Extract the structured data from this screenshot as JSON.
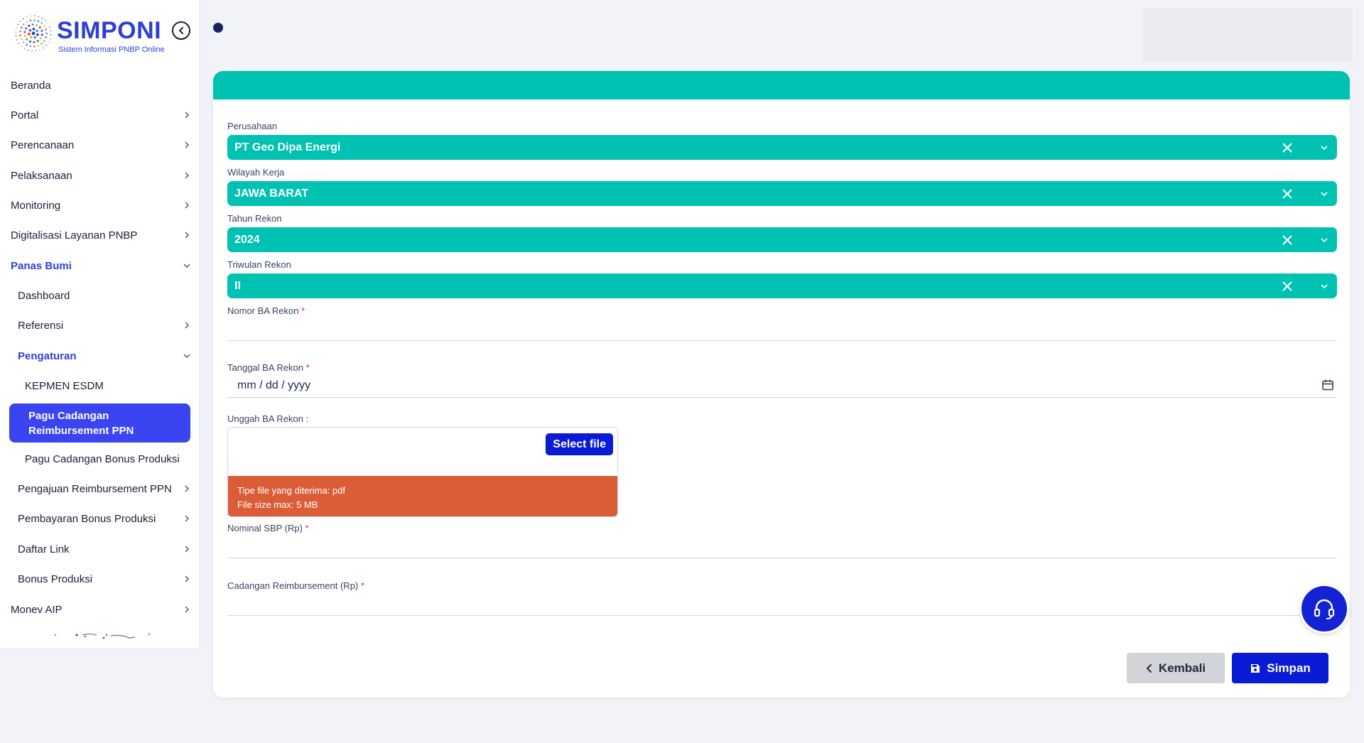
{
  "brand": {
    "title": "SIMPONI",
    "subtitle": "Sistem Informasi PNBP Online"
  },
  "sidebar": {
    "items": [
      {
        "label": "Beranda",
        "chevron": "none"
      },
      {
        "label": "Portal",
        "chevron": "right"
      },
      {
        "label": "Perencanaan",
        "chevron": "right"
      },
      {
        "label": "Pelaksanaan",
        "chevron": "right"
      },
      {
        "label": "Monitoring",
        "chevron": "right"
      },
      {
        "label": "Digitalisasi Layanan PNBP",
        "chevron": "right"
      },
      {
        "label": "Panas Bumi",
        "chevron": "down"
      },
      {
        "label": "Dashboard",
        "chevron": "none"
      },
      {
        "label": "Referensi",
        "chevron": "right"
      },
      {
        "label": "Pengaturan",
        "chevron": "down"
      },
      {
        "label": "KEPMEN ESDM",
        "chevron": "none"
      },
      {
        "label": "Pagu Cadangan Reimbursement PPN",
        "chevron": "none"
      },
      {
        "label": "Pagu Cadangan Bonus Produksi",
        "chevron": "none"
      },
      {
        "label": "Pengajuan Reimbursement PPN",
        "chevron": "right"
      },
      {
        "label": "Pembayaran Bonus Produksi",
        "chevron": "right"
      },
      {
        "label": "Daftar Link",
        "chevron": "right"
      },
      {
        "label": "Bonus Produksi",
        "chevron": "right"
      },
      {
        "label": "Monev AIP",
        "chevron": "right"
      }
    ],
    "active_line1": "Pagu Cadangan",
    "active_line2": "Reimbursement PPN"
  },
  "form": {
    "perusahaan": {
      "label": "Perusahaan",
      "value": "PT Geo Dipa Energi"
    },
    "wilayah": {
      "label": "Wilayah Kerja",
      "value": "JAWA BARAT"
    },
    "tahun": {
      "label": "Tahun Rekon",
      "value": "2024"
    },
    "triwulan": {
      "label": "Triwulan Rekon",
      "value": "II"
    },
    "nomor_ba": {
      "label": "Nomor BA Rekon",
      "required": "*",
      "value": ""
    },
    "tanggal_ba": {
      "label": "Tanggal BA Rekon",
      "required": "*",
      "placeholder": "mm / dd / yyyy"
    },
    "unggah": {
      "label": "Unggah BA Rekon :",
      "button": "Select file",
      "note_line1": "Tipe file yang diterima: pdf",
      "note_line2": "File size max: 5 MB"
    },
    "nominal_sbp": {
      "label": "Nominal SBP (Rp)",
      "required": "*",
      "value": ""
    },
    "cadangan": {
      "label": "Cadangan Reimbursement (Rp)",
      "required": "*",
      "value": ""
    }
  },
  "actions": {
    "back": "Kembali",
    "save": "Simpan"
  },
  "colors": {
    "teal": "#00c2b2",
    "primary": "#0a1bd6",
    "active_nav": "#3a44f0",
    "warning": "#db5d38"
  },
  "icons": {
    "collapse": "chevron-left-circle-icon",
    "clear": "close-icon",
    "caret": "chevron-down-icon",
    "calendar": "calendar-icon",
    "save": "floppy-disk-icon",
    "back": "chevron-left-icon",
    "help": "headset-icon"
  }
}
